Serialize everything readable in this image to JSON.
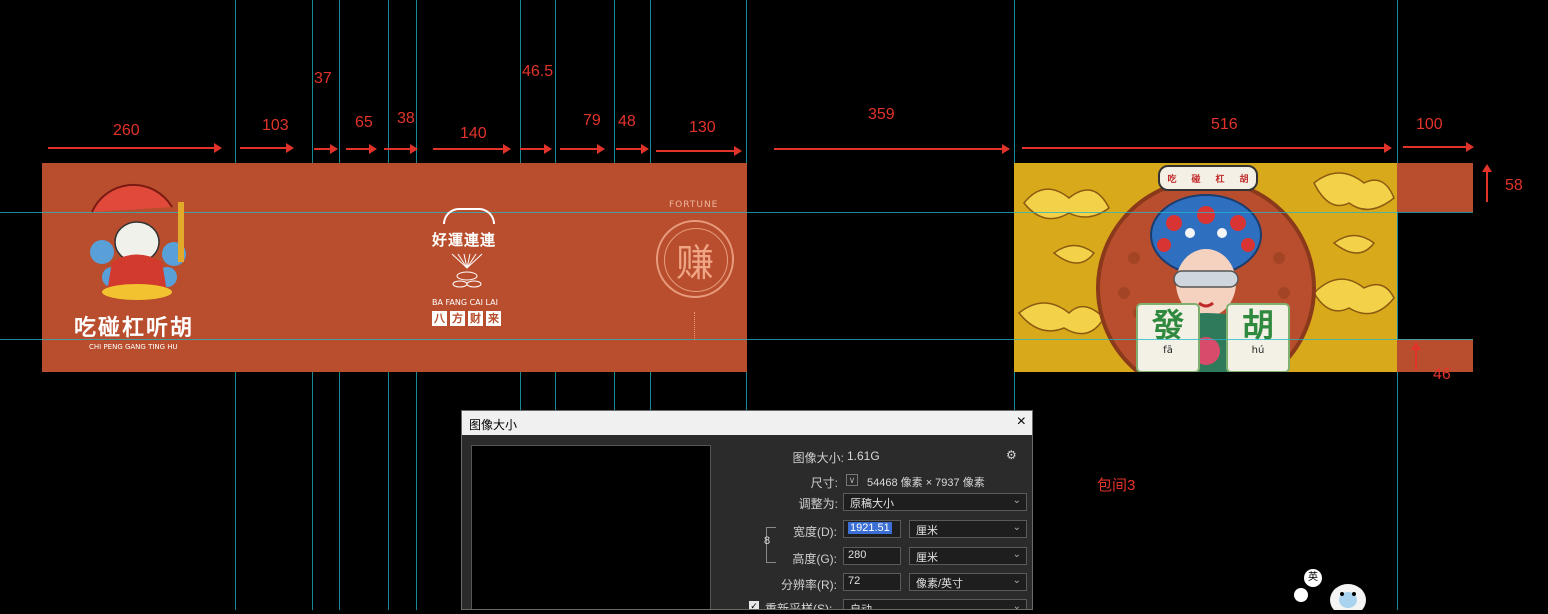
{
  "dimensions": {
    "top": [
      "260",
      "103",
      "37",
      "65",
      "38",
      "140",
      "46.5",
      "79",
      "48",
      "130",
      "359",
      "516",
      "100"
    ],
    "right_top": "58",
    "right_bottom": "46"
  },
  "design": {
    "left_logo_title": "吃碰杠听胡",
    "left_logo_sub": "CHI PENG GANG TING HU",
    "mid_title": "好運連連",
    "mid_sub": "BA FANG CAI LAI",
    "mid_chars": [
      "八",
      "方",
      "财",
      "来"
    ],
    "fortune_label": "FORTUNE",
    "fortune_char": "赚",
    "banner_chars": [
      "吃",
      "碰",
      "杠",
      "胡"
    ],
    "tile_left_char": "發",
    "tile_left_pinyin": "fā",
    "tile_right_char": "胡",
    "tile_right_pinyin": "hú",
    "room_label": "包间3",
    "badge_char": "英"
  },
  "dialog": {
    "title": "图像大小",
    "close_icon": "×",
    "image_size_label": "图像大小:",
    "image_size_value": "1.61G",
    "gear_icon": "⚙",
    "dimensions_label": "尺寸:",
    "dimensions_value": "54468 像素 × 7937 像素",
    "fit_label": "调整为:",
    "fit_value": "原稿大小",
    "width_label": "宽度(D):",
    "width_value": "1921.51",
    "width_unit": "厘米",
    "height_label": "高度(G):",
    "height_value": "280",
    "height_unit": "厘米",
    "resolution_label": "分辨率(R):",
    "resolution_value": "72",
    "resolution_unit": "像素/英寸",
    "resample_label": "重新采样(S):",
    "resample_value": "自动"
  },
  "colors": {
    "band": "#b84e2d",
    "guide": "#1fb8c8",
    "annotation": "#e2332b"
  }
}
